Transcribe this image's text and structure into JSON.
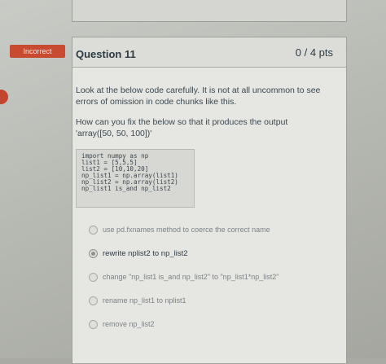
{
  "badge": {
    "label": "Incorrect",
    "color": "#c84a31"
  },
  "question": {
    "title": "Question 11",
    "points": "0 / 4 pts",
    "prompt_paragraphs": [
      "Look at the below code carefully. It is not at all uncommon to see errors of omission in code chunks like this.",
      "How can you fix the below so that it produces the output 'array([50, 50, 100])'"
    ],
    "code_lines": [
      "import numpy as np",
      "list1 = [5,5,5]",
      "list2 = [10,10,20]",
      "np_list1 = np.array(list1)",
      "np_list2 = np.array(list2)",
      "np_list1 is_and np_list2"
    ]
  },
  "answers": [
    {
      "label": "use pd.fxnames method to coerce the correct name",
      "selected": false
    },
    {
      "label": "rewrite nplist2 to np_list2",
      "selected": true
    },
    {
      "label": "change \"np_list1 is_and np_list2\" to \"np_list1*np_list2\"",
      "selected": false
    },
    {
      "label": "rename np_list1 to nplist1",
      "selected": false
    },
    {
      "label": "remove np_list2",
      "selected": false
    }
  ]
}
